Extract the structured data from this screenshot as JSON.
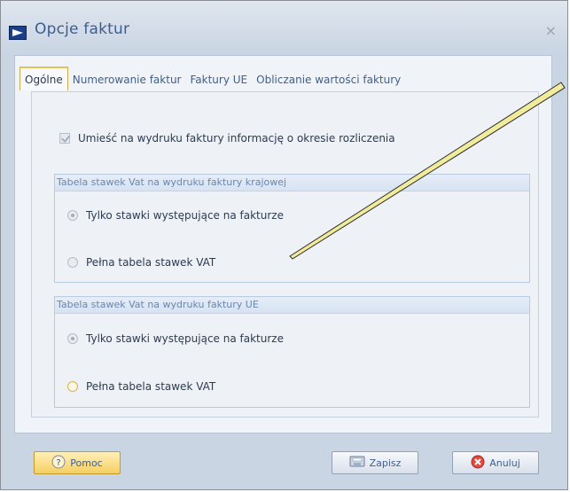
{
  "window": {
    "title": "Opcje faktur",
    "close_glyph": "×"
  },
  "tabs": [
    {
      "label": "Ogólne",
      "active": true
    },
    {
      "label": "Numerowanie faktur",
      "active": false
    },
    {
      "label": "Faktury UE",
      "active": false
    },
    {
      "label": "Obliczanie wartości faktury",
      "active": false
    }
  ],
  "general": {
    "billing_period_checkbox": {
      "label": "Umieść na wydruku faktury informację o okresie rozliczenia",
      "checked": true
    }
  },
  "domestic_group": {
    "title": "Tabela stawek Vat na wydruku faktury krajowej",
    "options": [
      {
        "label": "Tylko stawki występujące na fakturze",
        "checked": true
      },
      {
        "label": "Pełna tabela stawek VAT",
        "checked": false
      }
    ]
  },
  "eu_group": {
    "title": "Tabela stawek Vat na wydruku faktury UE",
    "options": [
      {
        "label": "Tylko stawki występujące na fakturze",
        "checked": true
      },
      {
        "label": "Pełna tabela stawek VAT",
        "checked": false
      }
    ]
  },
  "buttons": {
    "help": {
      "label": "Pomoc",
      "icon": "help-icon"
    },
    "save": {
      "label": "Zapisz",
      "icon": "save-icon"
    },
    "cancel": {
      "label": "Anuluj",
      "icon": "cancel-icon"
    }
  },
  "colors": {
    "accent": "#3c5e8f",
    "tab_highlight": "#e6c15a",
    "help_button": "#f6cf62",
    "callout_line": "#e8e08a"
  }
}
